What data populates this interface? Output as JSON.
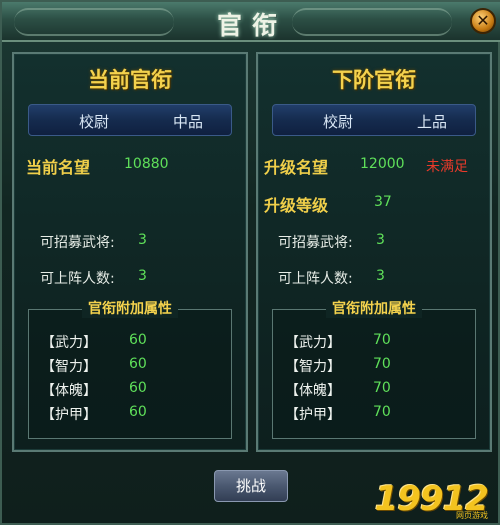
{
  "window": {
    "title": "官衔"
  },
  "current": {
    "heading": "当前官衔",
    "rank_name": "校尉",
    "rank_grade": "中品",
    "fame_label": "当前名望",
    "fame_value": "10880",
    "recruit_label": "可招募武将:",
    "recruit_value": "3",
    "lineup_label": "可上阵人数:",
    "lineup_value": "3",
    "attr_title": "官衔附加属性",
    "attrs": [
      {
        "name": "【武力】",
        "value": "60"
      },
      {
        "name": "【智力】",
        "value": "60"
      },
      {
        "name": "【体魄】",
        "value": "60"
      },
      {
        "name": "【护甲】",
        "value": "60"
      }
    ]
  },
  "next": {
    "heading": "下阶官衔",
    "rank_name": "校尉",
    "rank_grade": "上品",
    "fame_label": "升级名望",
    "fame_value": "12000",
    "fame_status": "未满足",
    "level_label": "升级等级",
    "level_value": "37",
    "recruit_label": "可招募武将:",
    "recruit_value": "3",
    "lineup_label": "可上阵人数:",
    "lineup_value": "3",
    "attr_title": "官衔附加属性",
    "attrs": [
      {
        "name": "【武力】",
        "value": "70"
      },
      {
        "name": "【智力】",
        "value": "70"
      },
      {
        "name": "【体魄】",
        "value": "70"
      },
      {
        "name": "【护甲】",
        "value": "70"
      }
    ]
  },
  "actions": {
    "challenge_label": "挑战"
  },
  "watermark": {
    "text": "19912",
    "sub": "网页游戏"
  },
  "icons": {
    "close": "close-icon"
  },
  "colors": {
    "gold": "#f4d24d",
    "green": "#5fe05a",
    "red": "#e83a2a"
  }
}
